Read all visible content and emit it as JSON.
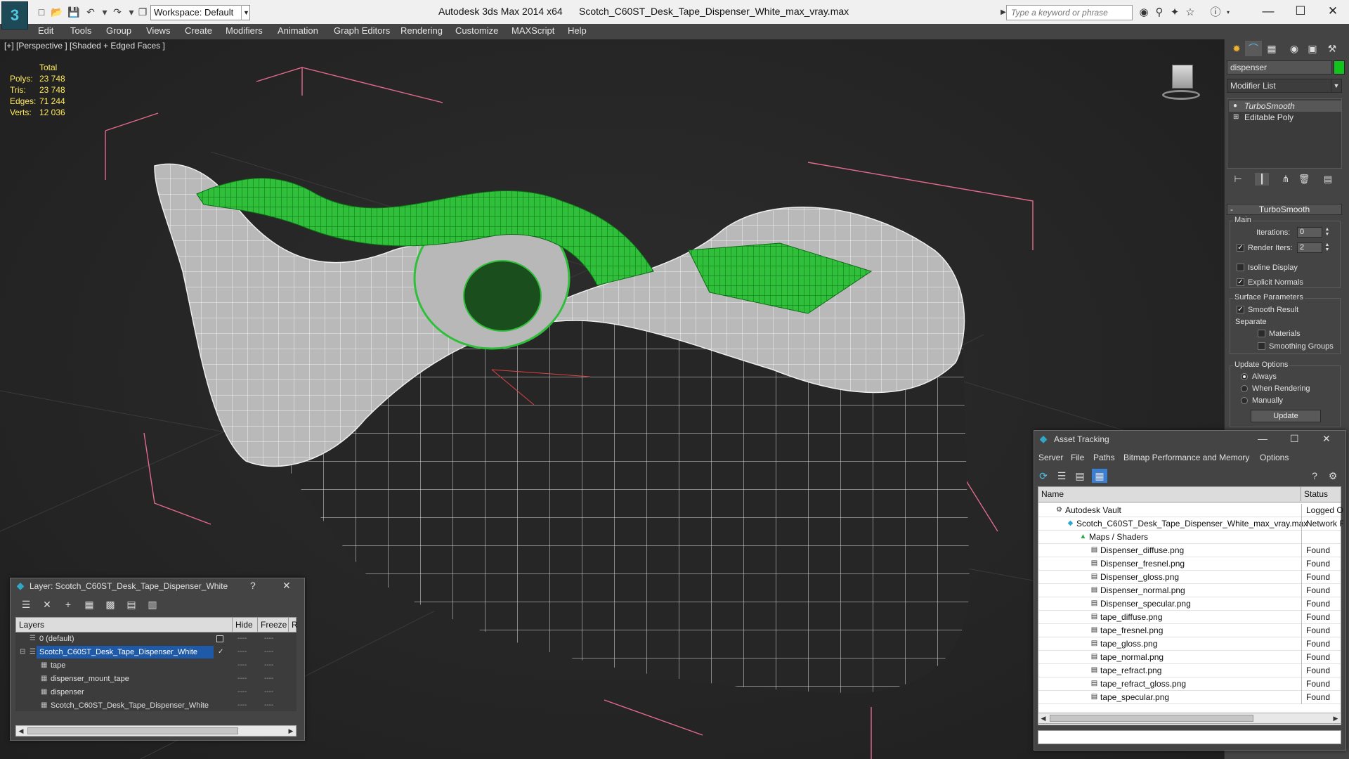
{
  "app": {
    "name": "Autodesk 3ds Max  2014 x64",
    "file": "Scotch_C60ST_Desk_Tape_Dispenser_White_max_vray.max",
    "logo": "3",
    "workspace": "Workspace: Default",
    "search_placeholder": "Type a keyword or phrase"
  },
  "menu": [
    "Edit",
    "Tools",
    "Group",
    "Views",
    "Create",
    "Modifiers",
    "Animation",
    "Graph Editors",
    "Rendering",
    "Customize",
    "MAXScript",
    "Help"
  ],
  "viewport": {
    "label": "[+] [Perspective ] [Shaded + Edged Faces ]",
    "stats": {
      "header": "Total",
      "rows": [
        {
          "label": "Polys:",
          "value": "23 748"
        },
        {
          "label": "Tris:",
          "value": "23 748"
        },
        {
          "label": "Edges:",
          "value": "71 244"
        },
        {
          "label": "Verts:",
          "value": "12 036"
        }
      ]
    }
  },
  "command_panel": {
    "object_name": "dispenser",
    "object_color": "#11c41d",
    "modifier_list": "Modifier List",
    "stack": [
      {
        "name": "TurboSmooth",
        "selected": true
      },
      {
        "name": "Editable Poly",
        "selected": false
      }
    ],
    "rollout": {
      "title": "TurboSmooth",
      "main": {
        "title": "Main",
        "iterations_label": "Iterations:",
        "iterations_value": "0",
        "render_iters_label": "Render Iters:",
        "render_iters_value": "2",
        "isoline": "Isoline Display",
        "explicit_normals": "Explicit Normals"
      },
      "surface": {
        "title": "Surface Parameters",
        "smooth_result": "Smooth Result",
        "separate": "Separate",
        "materials": "Materials",
        "smoothing_groups": "Smoothing Groups"
      },
      "update": {
        "title": "Update Options",
        "always": "Always",
        "when_rendering": "When Rendering",
        "manually": "Manually",
        "button": "Update"
      }
    }
  },
  "layer_dialog": {
    "title": "Layer: Scotch_C60ST_Desk_Tape_Dispenser_White",
    "help": "?",
    "columns": [
      "Layers",
      "Hide",
      "Freeze",
      "R"
    ],
    "rows": [
      {
        "name": "0 (default)",
        "indent": 1,
        "selected": false
      },
      {
        "name": "Scotch_C60ST_Desk_Tape_Dispenser_White",
        "indent": 1,
        "selected": true
      },
      {
        "name": "tape",
        "indent": 2,
        "selected": false
      },
      {
        "name": "dispenser_mount_tape",
        "indent": 2,
        "selected": false
      },
      {
        "name": "dispenser",
        "indent": 2,
        "selected": false
      },
      {
        "name": "Scotch_C60ST_Desk_Tape_Dispenser_White",
        "indent": 2,
        "selected": false
      }
    ],
    "dash": "----"
  },
  "asset_tracking": {
    "title": "Asset Tracking",
    "menu": [
      "Server",
      "File",
      "Paths",
      "Bitmap Performance and Memory",
      "Options"
    ],
    "columns": [
      "Name",
      "Status"
    ],
    "rows": [
      {
        "name": "Autodesk Vault",
        "status": "Logged O",
        "level": 1
      },
      {
        "name": "Scotch_C60ST_Desk_Tape_Dispenser_White_max_vray.max",
        "status": "Network F",
        "level": 2
      },
      {
        "name": "Maps / Shaders",
        "status": "",
        "level": 3
      },
      {
        "name": "Dispenser_diffuse.png",
        "status": "Found",
        "level": 4
      },
      {
        "name": "Dispenser_fresnel.png",
        "status": "Found",
        "level": 4
      },
      {
        "name": "Dispenser_gloss.png",
        "status": "Found",
        "level": 4
      },
      {
        "name": "Dispenser_normal.png",
        "status": "Found",
        "level": 4
      },
      {
        "name": "Dispenser_specular.png",
        "status": "Found",
        "level": 4
      },
      {
        "name": "tape_diffuse.png",
        "status": "Found",
        "level": 4
      },
      {
        "name": "tape_fresnel.png",
        "status": "Found",
        "level": 4
      },
      {
        "name": "tape_gloss.png",
        "status": "Found",
        "level": 4
      },
      {
        "name": "tape_normal.png",
        "status": "Found",
        "level": 4
      },
      {
        "name": "tape_refract.png",
        "status": "Found",
        "level": 4
      },
      {
        "name": "tape_refract_gloss.png",
        "status": "Found",
        "level": 4
      },
      {
        "name": "tape_specular.png",
        "status": "Found",
        "level": 4
      }
    ]
  },
  "colors": {
    "selection_green": "#22b030",
    "stats_yellow": "#ffeb5a",
    "bbox_pink": "#e36a8c",
    "layer_selected": "#1f5aa8"
  }
}
